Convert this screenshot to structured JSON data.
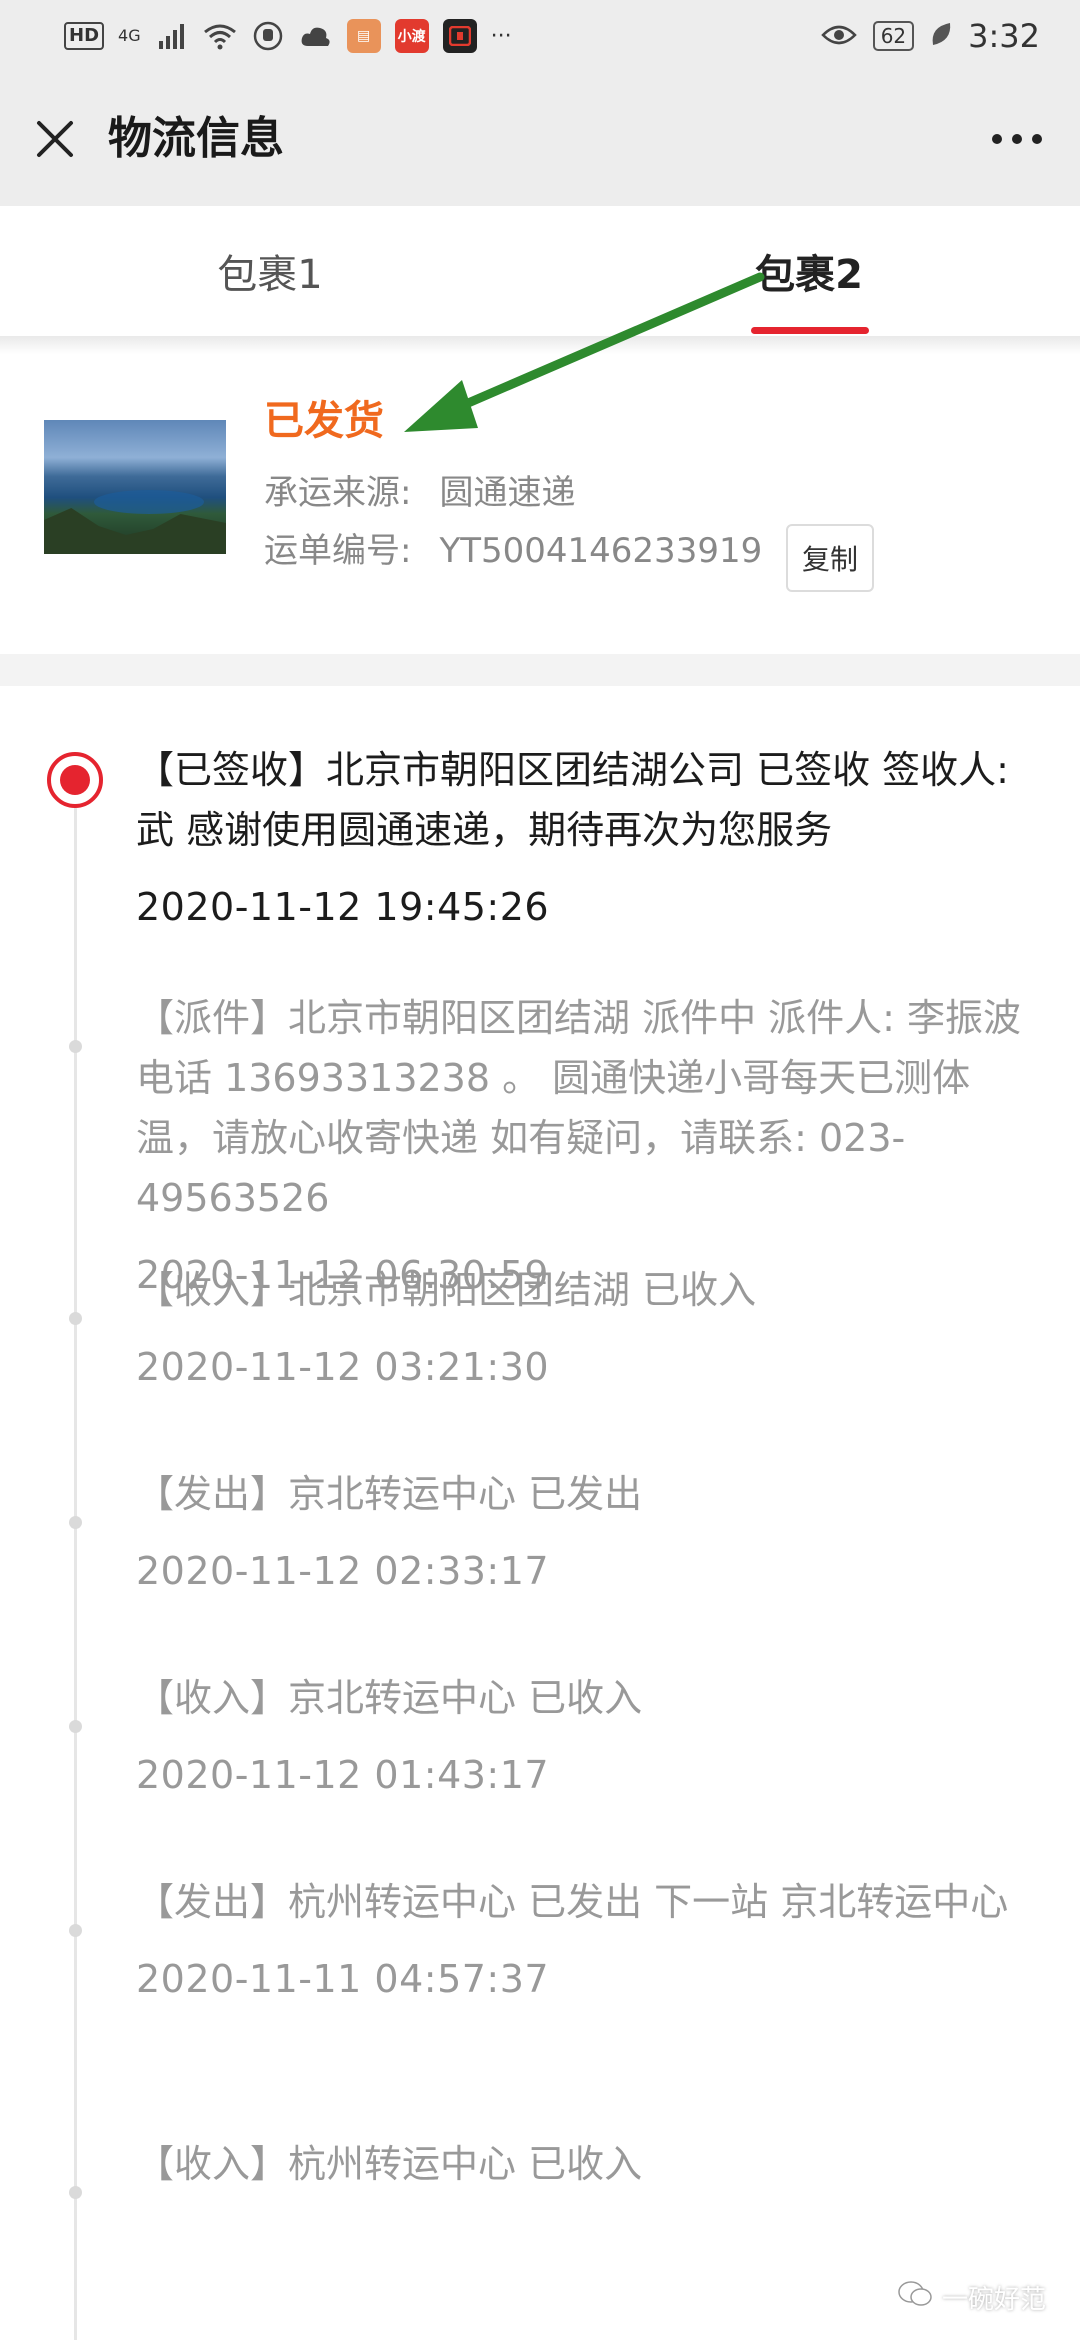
{
  "status_bar": {
    "hd": "HD",
    "signal": "4G",
    "icons": [
      "signal-icon",
      "wifi-icon",
      "hand-icon",
      "cloud-icon",
      "app-icon-1",
      "app-icon-2",
      "app-icon-3",
      "more-status-icon"
    ],
    "app2_label": "小渡",
    "more": "···",
    "battery": "62",
    "time": "3:32"
  },
  "header": {
    "title": "物流信息",
    "close_icon": "close-icon",
    "more_icon": "more-icon"
  },
  "tabs": [
    {
      "label": "包裹1",
      "active": false
    },
    {
      "label": "包裹2",
      "active": true
    }
  ],
  "package": {
    "status": "已发货",
    "carrier_label": "承运来源:",
    "carrier_value": "圆通速递",
    "tracking_label": "运单编号:",
    "tracking_value": "YT5004146233919",
    "copy_label": "复制",
    "status_color": "#f0691e"
  },
  "timeline": [
    {
      "text": "【已签收】北京市朝阳区团结湖公司 已签收 签收人:武 感谢使用圆通速递，期待再次为您服务",
      "time": "2020-11-12 19:45:26"
    },
    {
      "text": "【派件】北京市朝阳区团结湖 派件中 派件人: 李振波 电话 13693313238 。 圆通快递小哥每天已测体温，请放心收寄快递 如有疑问，请联系: 023-49563526",
      "time": "2020-11-12 06:30:59"
    },
    {
      "text": "【收入】北京市朝阳区团结湖 已收入",
      "time": "2020-11-12 03:21:30"
    },
    {
      "text": "【发出】京北转运中心 已发出",
      "time": "2020-11-12 02:33:17"
    },
    {
      "text": "【收入】京北转运中心 已收入",
      "time": "2020-11-12 01:43:17"
    },
    {
      "text": "【发出】杭州转运中心 已发出 下一站 京北转运中心",
      "time": "2020-11-11 04:57:37"
    },
    {
      "text": "【收入】杭州转运中心 已收入",
      "time": ""
    }
  ],
  "watermark": "一碗好范",
  "accent_color": "#e5242f"
}
